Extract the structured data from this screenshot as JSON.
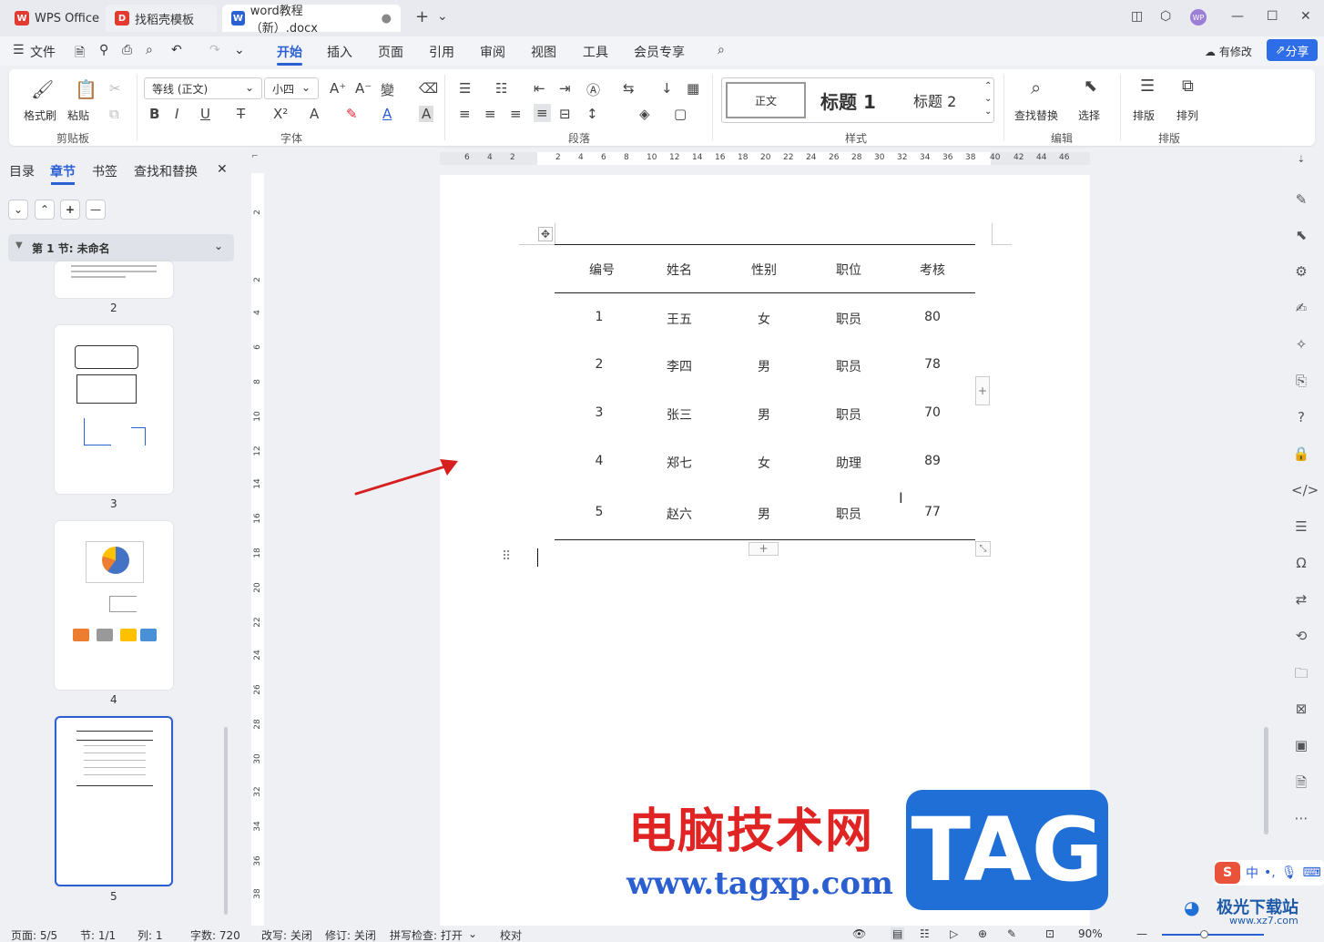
{
  "titlebar": {
    "tabs": [
      {
        "label": "WPS Office",
        "icon": "wps-logo-icon"
      },
      {
        "label": "找稻壳模板",
        "icon": "docer-icon"
      },
      {
        "label": "word教程（新）.docx",
        "icon": "word-doc-icon"
      }
    ],
    "new_tab": "+",
    "avatar": "WP"
  },
  "menubar": {
    "file": "文件",
    "tabs": [
      "开始",
      "插入",
      "页面",
      "引用",
      "审阅",
      "视图",
      "工具",
      "会员专享"
    ],
    "active_tab": "开始",
    "revise": "有修改",
    "share": "分享"
  },
  "ribbon": {
    "clipboard": {
      "label": "剪贴板",
      "format_painter": "格式刷",
      "paste": "粘贴"
    },
    "font": {
      "label": "字体",
      "font_name": "等线 (正文)",
      "font_size": "小四"
    },
    "paragraph": {
      "label": "段落"
    },
    "styles": {
      "label": "样式",
      "normal": "正文",
      "heading1": "标题  1",
      "heading2": "标题  2"
    },
    "edit": {
      "label": "编辑",
      "find_replace": "查找替换",
      "select": "选择"
    },
    "layout": {
      "label": "排版",
      "typeset": "排版",
      "arrange": "排列"
    }
  },
  "leftpanel": {
    "tabs": [
      "目录",
      "章节",
      "书签",
      "查找和替换"
    ],
    "active_tab": "章节",
    "section_title": "第 1 节: 未命名",
    "pages": [
      "2",
      "3",
      "4",
      "5"
    ],
    "selected_page": "5"
  },
  "rulers": {
    "horizontal": [
      "6",
      "4",
      "2",
      "2",
      "4",
      "6",
      "8",
      "10",
      "12",
      "14",
      "16",
      "18",
      "20",
      "22",
      "24",
      "26",
      "28",
      "30",
      "32",
      "34",
      "36",
      "38",
      "40",
      "42",
      "44",
      "46"
    ],
    "vertical": [
      "2",
      "2",
      "4",
      "6",
      "8",
      "10",
      "12",
      "14",
      "16",
      "18",
      "20",
      "22",
      "24",
      "26",
      "28",
      "30",
      "32",
      "34",
      "36",
      "38"
    ]
  },
  "table": {
    "headers": [
      "编号",
      "姓名",
      "性别",
      "职位",
      "考核"
    ],
    "rows": [
      [
        "1",
        "王五",
        "女",
        "职员",
        "80"
      ],
      [
        "2",
        "李四",
        "男",
        "职员",
        "78"
      ],
      [
        "3",
        "张三",
        "男",
        "职员",
        "70"
      ],
      [
        "4",
        "郑七",
        "女",
        "助理",
        "89"
      ],
      [
        "5",
        "赵六",
        "男",
        "职员",
        "77"
      ]
    ]
  },
  "statusbar": {
    "page": "页面: 5/5",
    "section": "节: 1/1",
    "column": "列: 1",
    "words": "字数: 720",
    "overwrite": "改写: 关闭",
    "track": "修订: 关闭",
    "spell": "拼写检查: 打开",
    "proof": "校对",
    "zoom": "90%"
  },
  "watermark": {
    "site_name": "电脑技术网",
    "url": "www.tagxp.com",
    "tag": "TAG",
    "brand2": "极光下载站",
    "url2": "www.xz7.com",
    "ime": "中"
  },
  "colors": {
    "accent": "#2b60d4",
    "share": "#2d6ee8",
    "arrow": "#d62020",
    "watermark_red": "#e02424",
    "tag_blue": "#1f6fd6"
  }
}
